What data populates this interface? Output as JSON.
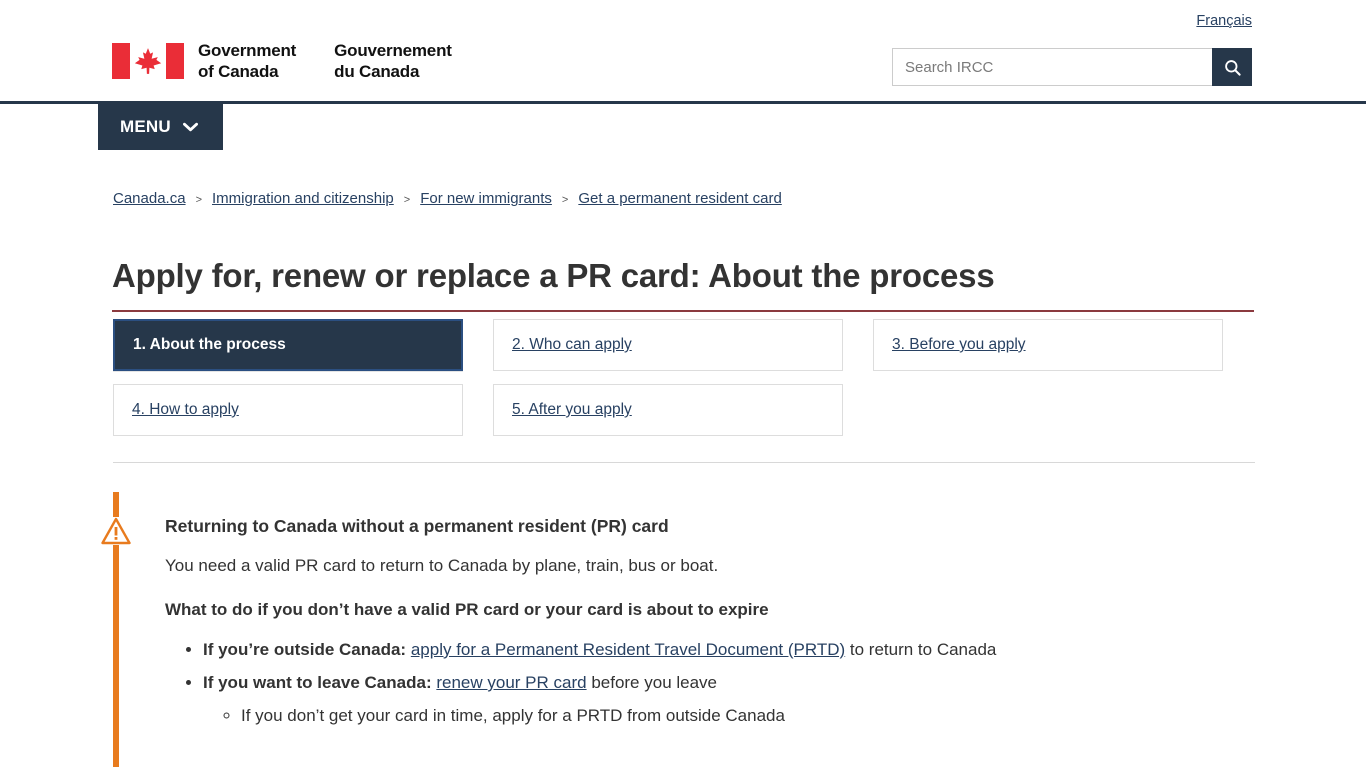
{
  "header": {
    "lang_toggle": "Français",
    "wordmark_en": [
      "Government",
      "of Canada"
    ],
    "wordmark_fr": [
      "Gouvernement",
      "du Canada"
    ],
    "flag_icon": "canada-flag-icon",
    "search": {
      "placeholder": "Search IRCC",
      "value": "",
      "button_icon": "search-icon"
    }
  },
  "menu": {
    "label": "MENU",
    "chevron_icon": "chevron-down-icon"
  },
  "breadcrumb": {
    "separator": ">",
    "items": [
      {
        "label": "Canada.ca"
      },
      {
        "label": "Immigration and citizenship"
      },
      {
        "label": "For new immigrants"
      },
      {
        "label": "Get a permanent resident card"
      }
    ]
  },
  "page": {
    "title": "Apply for, renew or replace a PR card: About the process"
  },
  "steps": [
    {
      "label": "1. About the process",
      "active": true
    },
    {
      "label": "2. Who can apply",
      "active": false
    },
    {
      "label": "3. Before you apply",
      "active": false
    },
    {
      "label": "4. How to apply",
      "active": false
    },
    {
      "label": "5. After you apply",
      "active": false
    }
  ],
  "alert": {
    "icon": "warning-triangle-icon",
    "heading": "Returning to Canada without a permanent resident (PR) card",
    "intro": "You need a valid PR card to return to Canada by plane, train, bus or boat.",
    "subheading": "What to do if you don’t have a valid PR card or your card is about to expire",
    "bullets": [
      {
        "lead": "If you’re outside Canada:",
        "link": "apply for a Permanent Resident Travel Document (PRTD)",
        "tail": "to return to Canada"
      },
      {
        "lead": "If you want to leave Canada:",
        "link": "renew your PR card",
        "tail": "before you leave",
        "sub": "If you don’t get your card in time, apply for a PRTD from outside Canada"
      }
    ]
  },
  "colors": {
    "navy": "#26374a",
    "flag_red": "#ea2d37",
    "link": "#284162",
    "title_rule": "#8b3a3f",
    "alert_orange": "#e87b1e"
  }
}
